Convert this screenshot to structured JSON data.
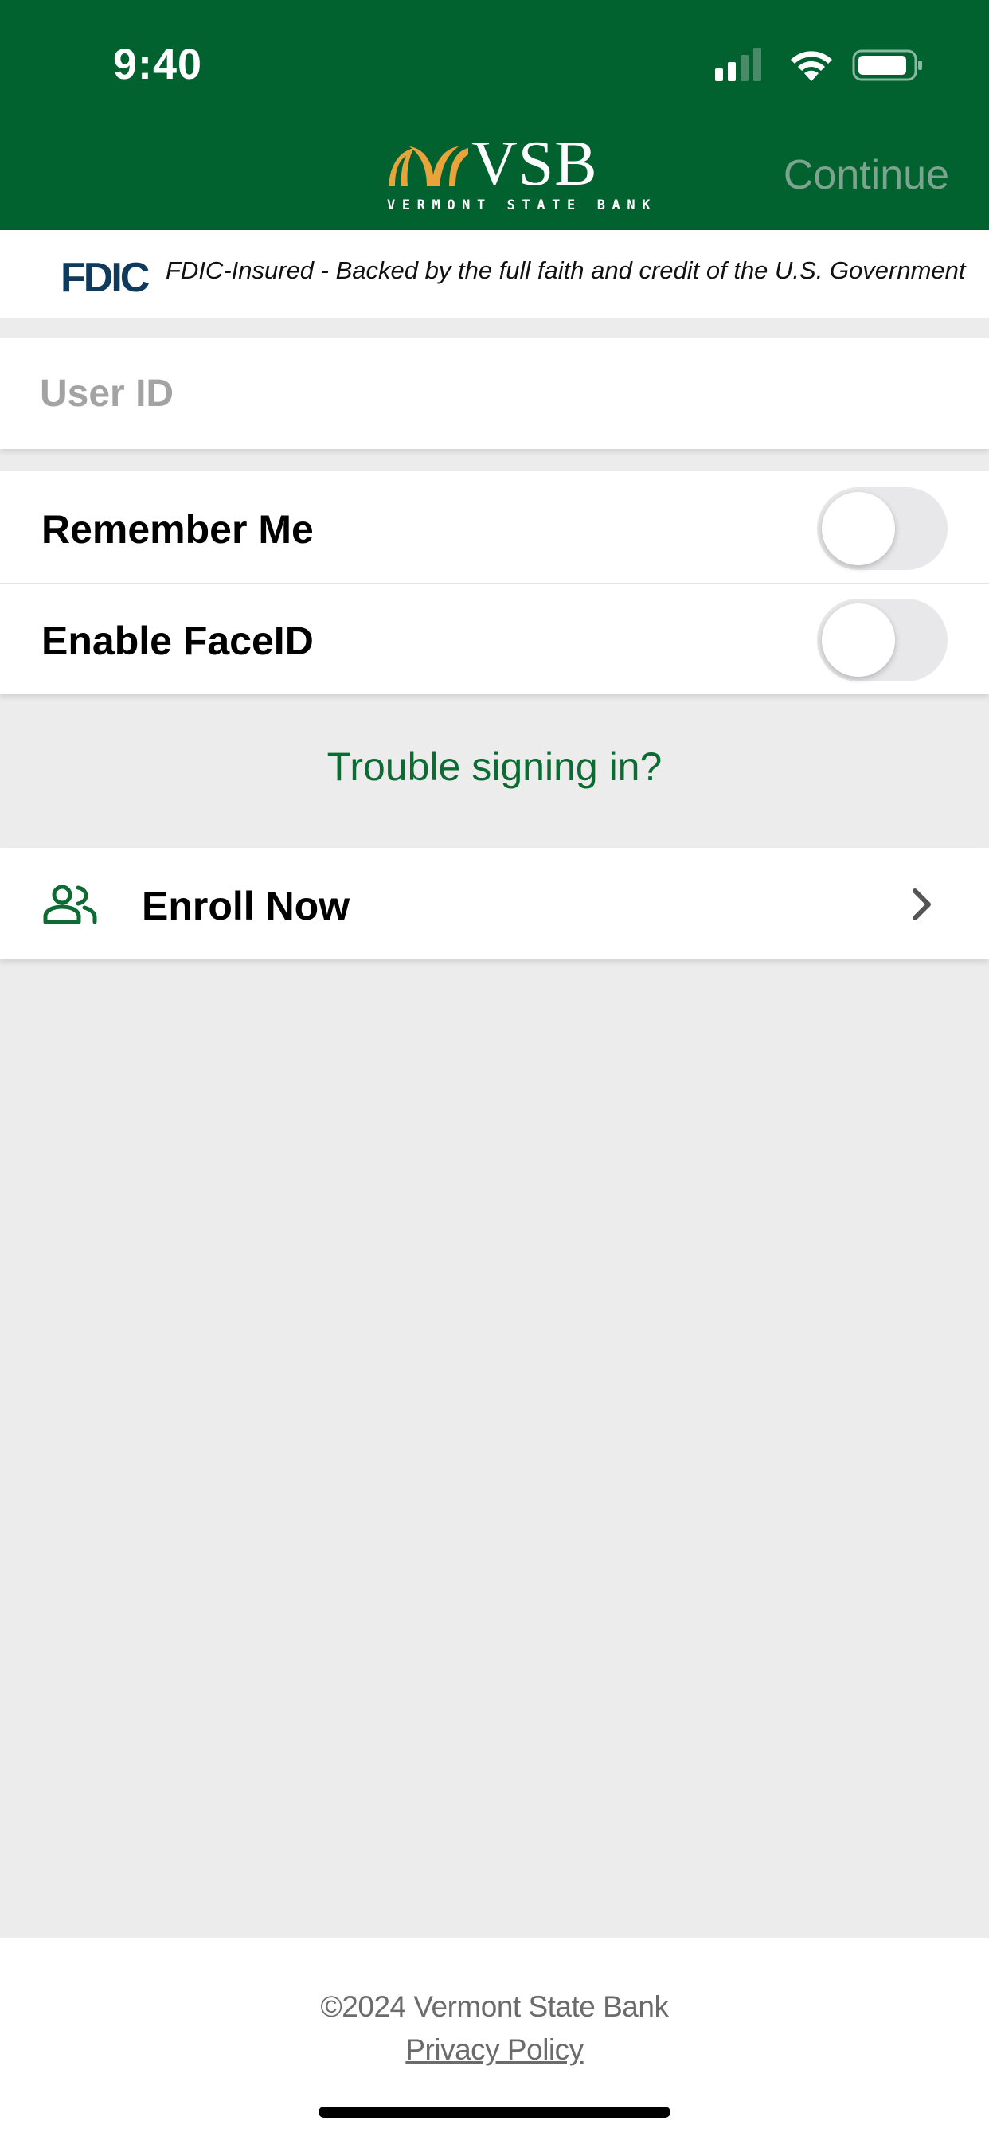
{
  "status_bar": {
    "time": "9:40"
  },
  "header": {
    "logo_text": "VSB",
    "logo_subtitle": "VERMONT STATE BANK",
    "continue_label": "Continue"
  },
  "fdic": {
    "logo": "FDIC",
    "text": "FDIC-Insured - Backed by the full faith and credit of the U.S. Government"
  },
  "login": {
    "user_id_placeholder": "User ID",
    "user_id_value": ""
  },
  "settings": {
    "remember_me_label": "Remember Me",
    "remember_me_on": false,
    "faceid_label": "Enable FaceID",
    "faceid_on": false
  },
  "trouble_link": "Trouble signing in?",
  "enroll": {
    "label": "Enroll Now",
    "icon": "people-icon"
  },
  "footer": {
    "copyright": "©2024 Vermont State Bank",
    "privacy_link": "Privacy Policy"
  },
  "colors": {
    "header_green": "#016230",
    "accent_green": "#0c6b33",
    "logo_gold": "#e8a33a",
    "background": "#ececec"
  }
}
